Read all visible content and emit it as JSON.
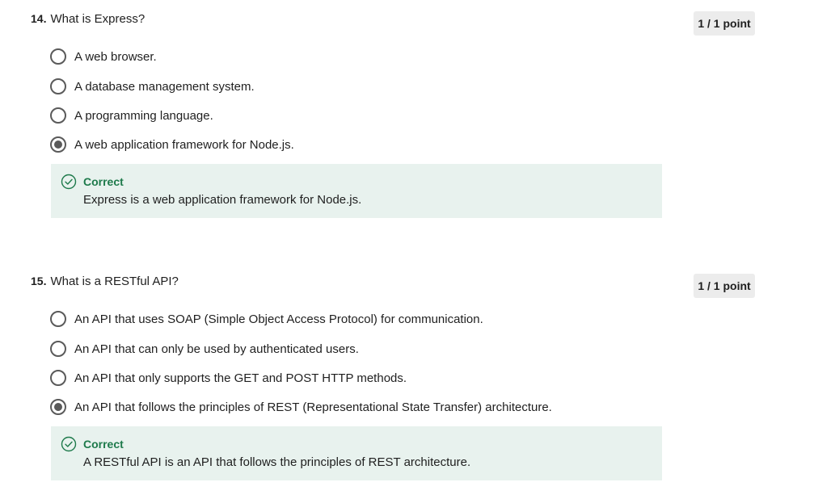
{
  "questions": [
    {
      "number": "14.",
      "text": "What is Express?",
      "points": "1 / 1 point",
      "options": [
        {
          "label": "A web browser.",
          "selected": false
        },
        {
          "label": "A database management system.",
          "selected": false
        },
        {
          "label": "A programming language.",
          "selected": false
        },
        {
          "label": "A web application framework for Node.js.",
          "selected": true
        }
      ],
      "feedback": {
        "status": "Correct",
        "icon": "check-circle-icon",
        "text": "Express is a web application framework for Node.js."
      }
    },
    {
      "number": "15.",
      "text": "What is a RESTful API?",
      "points": "1 / 1 point",
      "options": [
        {
          "label": "An API that uses SOAP (Simple Object Access Protocol) for communication.",
          "selected": false
        },
        {
          "label": "An API that can only be used by authenticated users.",
          "selected": false
        },
        {
          "label": "An API that only supports the GET and POST HTTP methods.",
          "selected": false
        },
        {
          "label": "An API that follows the principles of REST (Representational State Transfer) architecture.",
          "selected": true
        }
      ],
      "feedback": {
        "status": "Correct",
        "icon": "check-circle-icon",
        "text": "A RESTful API is an API that follows the principles of REST architecture."
      }
    }
  ],
  "colors": {
    "correct": "#1e7a4b",
    "feedback_bg": "#e8f2ee",
    "badge_bg": "#ececec",
    "radio": "#5a5a5a"
  }
}
